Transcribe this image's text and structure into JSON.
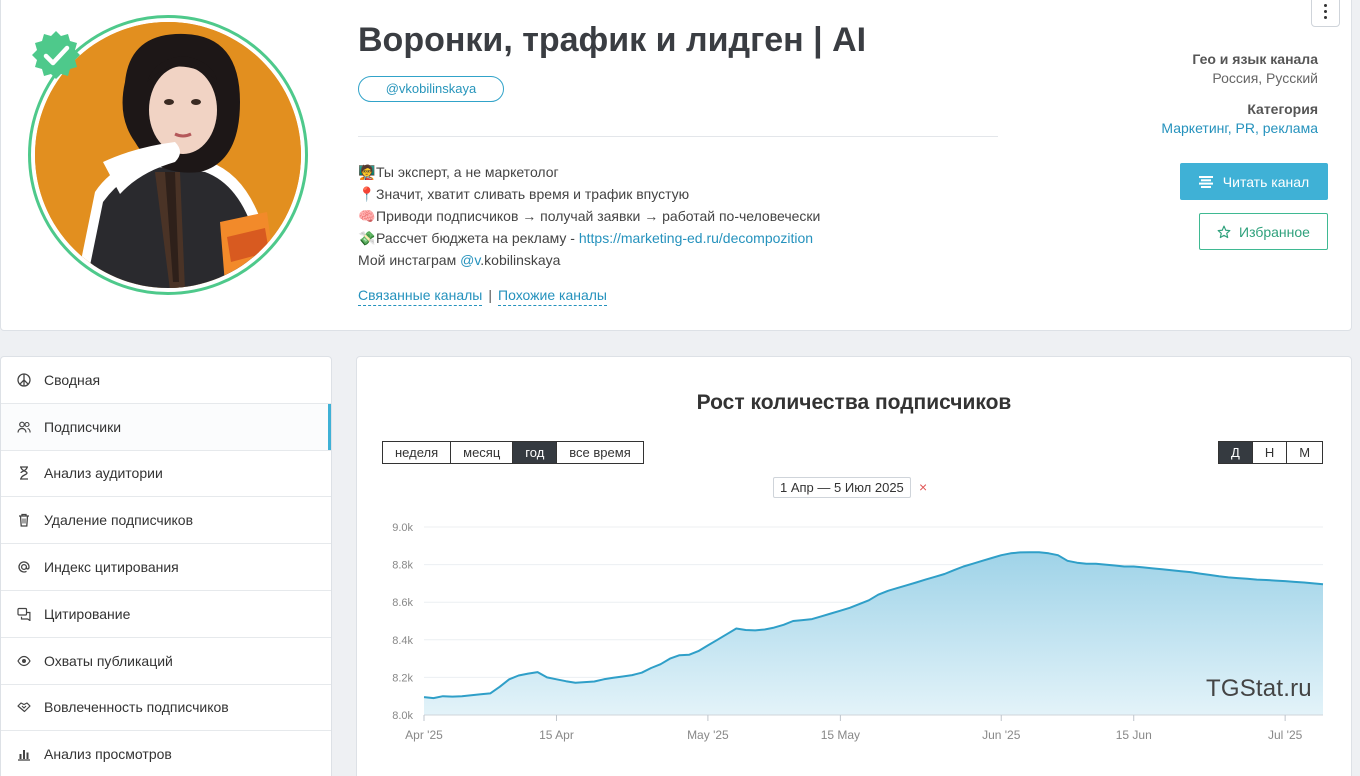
{
  "channel": {
    "title": "Воронки, трафик и лидген | AI",
    "handle": "@vkobilinskaya",
    "description": [
      {
        "emoji": "🧑‍🏫",
        "parts": [
          {
            "text": "Ты эксперт, а не маркетолог"
          }
        ]
      },
      {
        "emoji": "📍",
        "parts": [
          {
            "text": "Значит, хватит сливать время и трафик впустую"
          }
        ]
      },
      {
        "emoji": "🧠",
        "parts": [
          {
            "text": "Приводи подписчиков → получай заявки → работай по-человечески"
          }
        ]
      },
      {
        "emoji": "💸",
        "parts": [
          {
            "text": "Рассчет бюджета на рекламу - "
          },
          {
            "text": "https://marketing-ed.ru/decompozition",
            "link": true
          }
        ]
      },
      {
        "emoji": "",
        "parts": [
          {
            "text": "Мой инстаграм "
          },
          {
            "text": "@v",
            "link": true
          },
          {
            "text": ".kobilinskaya"
          }
        ]
      }
    ],
    "related_label": "Связанные каналы",
    "similar_label": "Похожие каналы",
    "separator": "|"
  },
  "meta": {
    "geo_label": "Гео и язык канала",
    "geo_value": "Россия, Русский",
    "category_label": "Категория",
    "category_value": "Маркетинг, PR, реклама"
  },
  "buttons": {
    "read": "Читать канал",
    "favorite": "Избранное"
  },
  "sidebar": {
    "items": [
      {
        "label": "Сводная",
        "icon": "peace-icon",
        "active": false
      },
      {
        "label": "Подписчики",
        "icon": "users-icon",
        "active": true
      },
      {
        "label": "Анализ аудитории",
        "icon": "hourglass-icon",
        "active": false
      },
      {
        "label": "Удаление подписчиков",
        "icon": "trash-icon",
        "active": false
      },
      {
        "label": "Индекс цитирования",
        "icon": "at-icon",
        "active": false
      },
      {
        "label": "Цитирование",
        "icon": "quote-icon",
        "active": false
      },
      {
        "label": "Охваты публикаций",
        "icon": "eye-icon",
        "active": false
      },
      {
        "label": "Вовлеченность подписчиков",
        "icon": "handshake-icon",
        "active": false
      },
      {
        "label": "Анализ просмотров",
        "icon": "bar-chart-icon",
        "active": false
      }
    ]
  },
  "chart_panel": {
    "title": "Рост количества подписчиков",
    "periods": [
      {
        "label": "неделя",
        "active": false
      },
      {
        "label": "месяц",
        "active": false
      },
      {
        "label": "год",
        "active": true
      },
      {
        "label": "все время",
        "active": false
      }
    ],
    "granularity": [
      {
        "label": "Д",
        "active": true
      },
      {
        "label": "Н",
        "active": false
      },
      {
        "label": "М",
        "active": false
      }
    ],
    "range": "1 Апр — 5 Июл 2025",
    "range_clear": "×",
    "watermark": "TGStat.ru"
  },
  "colors": {
    "accent": "#3fb1d6",
    "line": "#2f9fc8",
    "verified": "#4ec98b",
    "favorite": "#3fb992"
  },
  "chart_data": {
    "type": "area",
    "ylim": [
      8000,
      9000
    ],
    "yticks": [
      "9.0k",
      "8.8k",
      "8.6k",
      "8.4k",
      "8.2k",
      "8.0k"
    ],
    "xticks": [
      {
        "label": "Apr '25",
        "day": 0
      },
      {
        "label": "15 Apr",
        "day": 14
      },
      {
        "label": "May '25",
        "day": 30
      },
      {
        "label": "15 May",
        "day": 44
      },
      {
        "label": "Jun '25",
        "day": 61
      },
      {
        "label": "15 Jun",
        "day": 75
      },
      {
        "label": "Jul '25",
        "day": 91
      }
    ],
    "xlim": [
      0,
      95
    ],
    "series": [
      {
        "values": [
          8095,
          8090,
          8100,
          8098,
          8100,
          8105,
          8110,
          8115,
          8150,
          8190,
          8210,
          8220,
          8228,
          8200,
          8190,
          8180,
          8172,
          8175,
          8178,
          8190,
          8198,
          8205,
          8212,
          8225,
          8250,
          8270,
          8300,
          8318,
          8320,
          8340,
          8370,
          8400,
          8430,
          8460,
          8452,
          8450,
          8455,
          8465,
          8480,
          8500,
          8505,
          8510,
          8525,
          8540,
          8555,
          8570,
          8590,
          8610,
          8640,
          8660,
          8675,
          8690,
          8705,
          8720,
          8735,
          8750,
          8770,
          8790,
          8805,
          8820,
          8835,
          8850,
          8860,
          8865,
          8866,
          8866,
          8860,
          8850,
          8820,
          8810,
          8805,
          8805,
          8800,
          8795,
          8790,
          8790,
          8785,
          8780,
          8775,
          8770,
          8765,
          8760,
          8752,
          8745,
          8738,
          8732,
          8728,
          8725,
          8720,
          8718,
          8715,
          8712,
          8708,
          8705,
          8700,
          8695
        ]
      }
    ]
  }
}
